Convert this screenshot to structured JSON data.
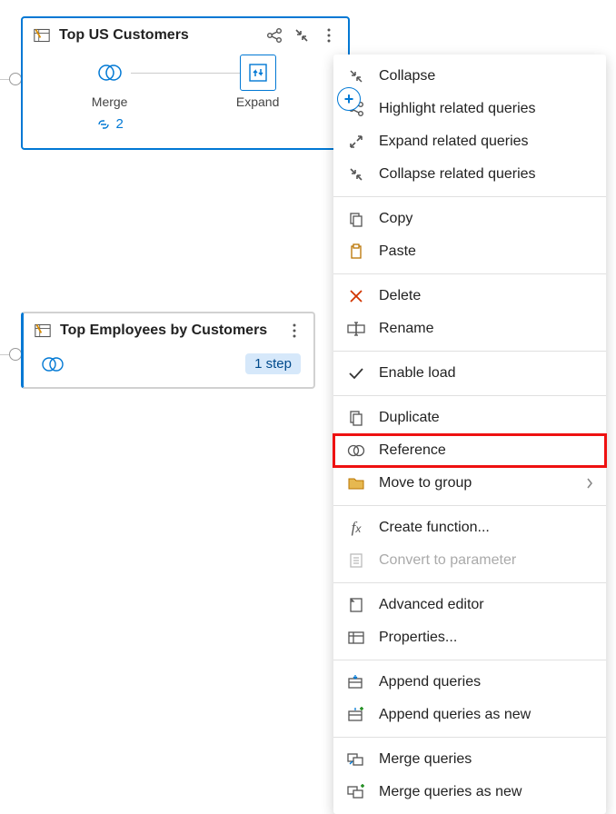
{
  "cards": {
    "top_us_customers": {
      "title": "Top US Customers",
      "steps": {
        "merge": "Merge",
        "expand": "Expand"
      },
      "ref_count": "2"
    },
    "top_employees": {
      "title": "Top Employees by Customers",
      "step_badge": "1 step"
    }
  },
  "menu": {
    "collapse": "Collapse",
    "highlight_related": "Highlight related queries",
    "expand_related": "Expand related queries",
    "collapse_related": "Collapse related queries",
    "copy": "Copy",
    "paste": "Paste",
    "delete": "Delete",
    "rename": "Rename",
    "enable_load": "Enable load",
    "duplicate": "Duplicate",
    "reference": "Reference",
    "move_to_group": "Move to group",
    "create_function": "Create function...",
    "convert_to_parameter": "Convert to parameter",
    "advanced_editor": "Advanced editor",
    "properties": "Properties...",
    "append_queries": "Append queries",
    "append_queries_new": "Append queries as new",
    "merge_queries": "Merge queries",
    "merge_queries_new": "Merge queries as new"
  }
}
